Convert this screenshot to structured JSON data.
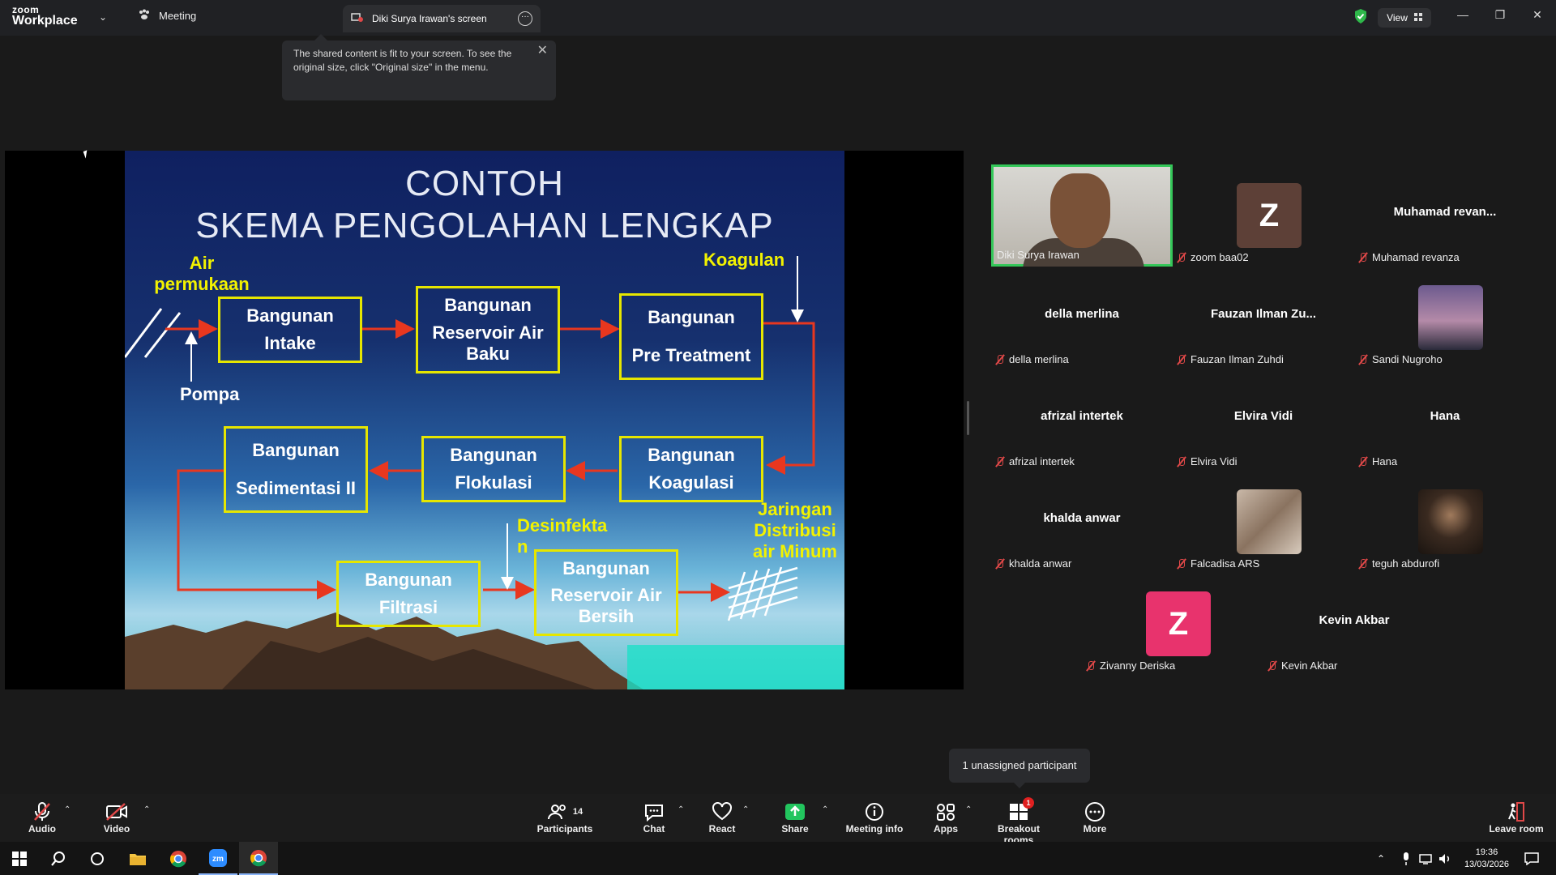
{
  "app": {
    "logo_line1": "zoom",
    "logo_line2": "Workplace",
    "meeting_label": "Meeting",
    "screen_tab": "Diki Surya Irawan's screen",
    "view_label": "View"
  },
  "tooltip": {
    "text": "The shared content is fit to your screen. To see the original size, click \"Original size\" in the menu."
  },
  "slide": {
    "title1": "CONTOH",
    "title2": "SKEMA PENGOLAHAN LENGKAP",
    "label_air": "Air",
    "label_permukaan": "permukaan",
    "label_pompa": "Pompa",
    "label_koagulan": "Koagulan",
    "label_desinfektan": "Desinfekta\nn",
    "label_jaringan": "Jaringan\nDistribusi\nair Minum",
    "boxes": {
      "intake": [
        "Bangunan",
        "Intake"
      ],
      "reservoir_baku": [
        "Bangunan",
        "Reservoir Air Baku"
      ],
      "pretreatment": [
        "Bangunan",
        "Pre Treatment"
      ],
      "koagulasi": [
        "Bangunan",
        "Koagulasi"
      ],
      "flokulasi": [
        "Bangunan",
        "Flokulasi"
      ],
      "sedimentasi": [
        "Bangunan",
        "Sedimentasi II"
      ],
      "filtrasi": [
        "Bangunan",
        "Filtrasi"
      ],
      "reservoir_bersih": [
        "Bangunan",
        "Reservoir Air Bersih"
      ]
    }
  },
  "participants": [
    {
      "display": "",
      "caption": "Diki Surya Irawan",
      "kind": "video"
    },
    {
      "display": "Z",
      "caption": "zoom baa02",
      "kind": "avatar",
      "color": "#5d4037"
    },
    {
      "display": "Muhamad  revan...",
      "caption": "Muhamad revanza",
      "kind": "name"
    },
    {
      "display": "della merlina",
      "caption": "della merlina",
      "kind": "name"
    },
    {
      "display": "Fauzan  Ilman  Zu...",
      "caption": "Fauzan Ilman Zuhdi",
      "kind": "name"
    },
    {
      "display": "",
      "caption": "Sandi Nugroho",
      "kind": "photo"
    },
    {
      "display": "afrizal intertek",
      "caption": "afrizal intertek",
      "kind": "name"
    },
    {
      "display": "Elvira Vidi",
      "caption": "Elvira Vidi",
      "kind": "name"
    },
    {
      "display": "Hana",
      "caption": "Hana",
      "kind": "name"
    },
    {
      "display": "khalda anwar",
      "caption": "khalda anwar",
      "kind": "name"
    },
    {
      "display": "",
      "caption": "Falcadisa ARS",
      "kind": "photo"
    },
    {
      "display": "",
      "caption": "teguh abdurofi",
      "kind": "photo"
    },
    {
      "display": "Z",
      "caption": "Zivanny Deriska",
      "kind": "avatar",
      "color": "#e8336d"
    },
    {
      "display": "Kevin Akbar",
      "caption": "Kevin Akbar",
      "kind": "name"
    }
  ],
  "unassigned": "1 unassigned participant",
  "toolbar": {
    "audio": "Audio",
    "video": "Video",
    "participants": "Participants",
    "participants_count": "14",
    "chat": "Chat",
    "react": "React",
    "share": "Share",
    "meeting_info": "Meeting info",
    "apps": "Apps",
    "breakout": "Breakout rooms",
    "breakout_badge": "1",
    "more": "More",
    "leave": "Leave room"
  },
  "taskbar": {
    "time": "19:36",
    "date": "13/03/2026"
  },
  "colors": {
    "accent_green": "#34c759",
    "box_yellow": "#e6e600",
    "arrow_red": "#e8371f"
  }
}
